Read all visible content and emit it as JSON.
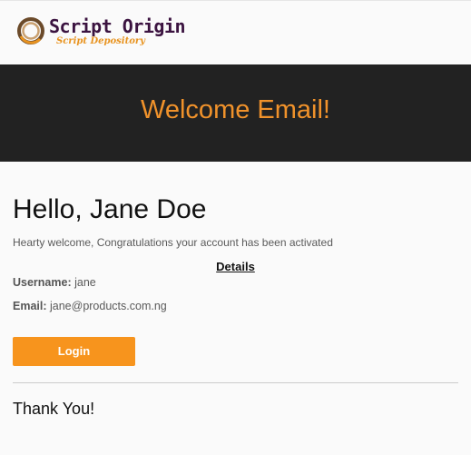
{
  "brand": {
    "name": "Script Origin",
    "tagline": "Script Depository",
    "logo_icon": "ring-logo-icon",
    "colors": {
      "name": "#3b1340",
      "tagline": "#e8931f"
    }
  },
  "banner": {
    "title": "Welcome Email!",
    "background": "#222222",
    "title_color": "#f0922b"
  },
  "content": {
    "greeting": "Hello, Jane Doe",
    "welcome_text": "Hearty welcome, Congratulations your account has been activated",
    "details_heading": "Details",
    "username": {
      "label": "Username:",
      "value": "jane"
    },
    "email": {
      "label": "Email:",
      "value": "jane@products.com.ng"
    },
    "login_label": "Login",
    "login_color": "#f7941d",
    "thanks": "Thank You!"
  }
}
